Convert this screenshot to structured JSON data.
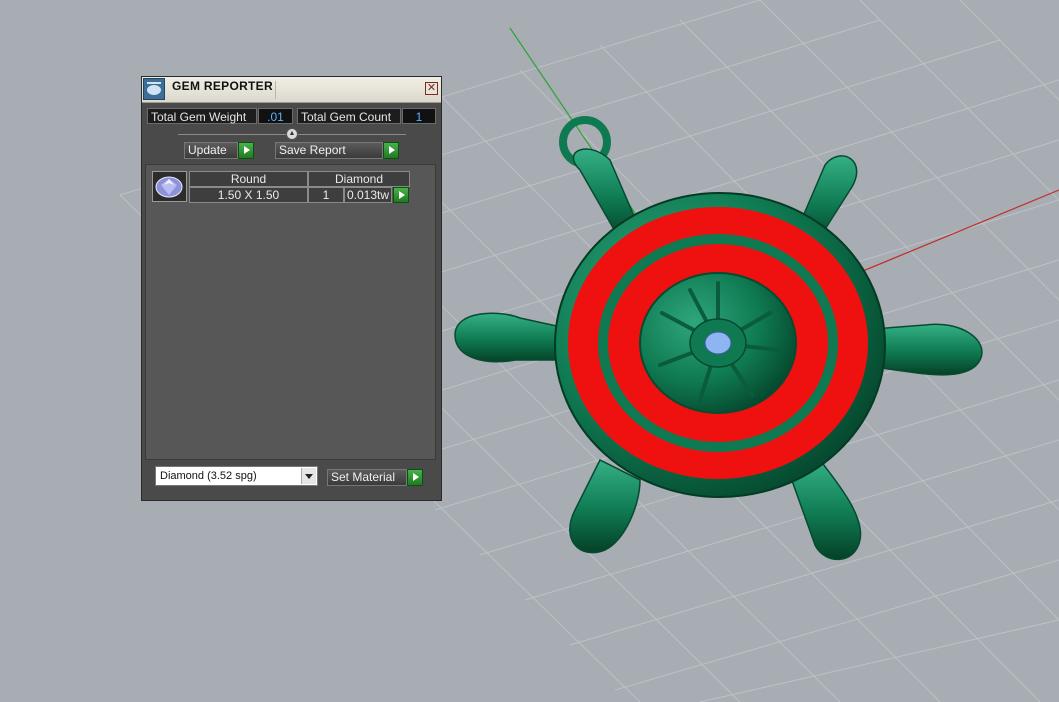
{
  "window": {
    "title": "GEM REPORTER",
    "close_glyph": "✕"
  },
  "stats": {
    "total_weight_label": "Total Gem Weight",
    "total_weight_value": ".01",
    "total_count_label": "Total Gem Count",
    "total_count_value": "1"
  },
  "toolbar": {
    "update_label": "Update",
    "save_report_label": "Save Report"
  },
  "gem_table": {
    "headers": {
      "shape": "Round",
      "material": "Diamond"
    },
    "rows": [
      {
        "size": "1.50 X 1.50",
        "count": "1",
        "weight": "0.013tw"
      }
    ]
  },
  "material_select": {
    "value": "Diamond     (3.52 spg)"
  },
  "set_material_label": "Set Material",
  "viewport": {
    "model_colors": {
      "metal": "#0f7a52",
      "enamel": "#ef1010",
      "gem": "#8fb4f2"
    },
    "background": "#a7adb2",
    "grid_color": "#bdc3c7",
    "x_axis_color": "#c42b2b",
    "y_axis_color": "#2fa336"
  }
}
